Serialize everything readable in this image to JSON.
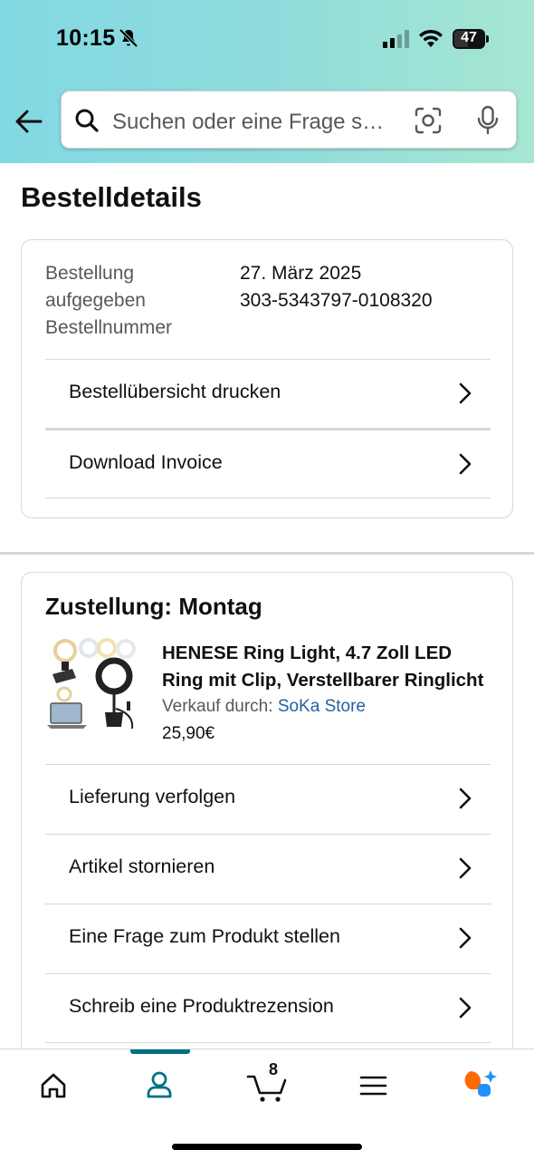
{
  "status_bar": {
    "time": "10:15",
    "battery_level": "47",
    "icons": [
      "bell-slash-icon",
      "signal-icon",
      "wifi-icon",
      "battery-icon"
    ]
  },
  "header": {
    "back_icon": "back-arrow-icon",
    "search_placeholder": "Suchen oder eine Frage s…",
    "camera_icon": "camera-scan-icon",
    "mic_icon": "microphone-icon"
  },
  "page": {
    "title": "Bestelldetails"
  },
  "order_info": {
    "placed_label": "Bestellung aufgegeben",
    "placed_label_line1": "Bestellung",
    "placed_label_line2": "aufgegeben",
    "number_label": "Bestellnummer",
    "placed_value": "27. März 2025",
    "number_value": "303-5343797-0108320",
    "actions": [
      {
        "label": "Bestellübersicht drucken"
      },
      {
        "label": "Download Invoice"
      }
    ]
  },
  "delivery": {
    "title": "Zustellung: Montag",
    "product": {
      "name": "HENESE Ring Light, 4.7 Zoll LED Ring mit Clip, Verstellbarer Ringlicht",
      "seller_prefix": "Verkauf durch:",
      "seller_name": "SoKa Store",
      "price": "25,90€",
      "image_icon": "product-ring-light-image"
    },
    "actions": [
      {
        "label": "Lieferung verfolgen"
      },
      {
        "label": "Artikel stornieren"
      },
      {
        "label": "Eine Frage zum Produkt stellen"
      },
      {
        "label": "Schreib eine Produktrezension"
      }
    ]
  },
  "bottom_nav": {
    "items": [
      {
        "name": "home",
        "icon": "home-icon"
      },
      {
        "name": "account",
        "icon": "person-icon",
        "active": true
      },
      {
        "name": "cart",
        "icon": "cart-icon",
        "count": "8"
      },
      {
        "name": "menu",
        "icon": "menu-icon"
      },
      {
        "name": "rufus",
        "icon": "assistant-icon"
      }
    ]
  },
  "colors": {
    "accent": "#007185",
    "link": "#2162a1",
    "header_gradient_start": "#82d8e3",
    "header_gradient_end": "#a6e6d2",
    "assistant_orange": "#ff6a00",
    "assistant_blue": "#1e90ff"
  }
}
